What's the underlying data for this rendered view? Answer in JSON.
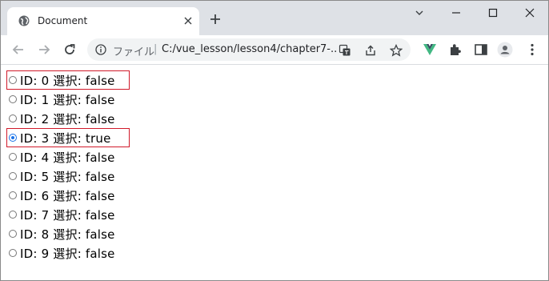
{
  "tab": {
    "title": "Document"
  },
  "omnibox": {
    "scheme_label": "ファイル",
    "separator": "|",
    "url": "C:/vue_lesson/lesson4/chapter7-..."
  },
  "colors": {
    "highlight_border": "#d11a2a",
    "radio_checked": "#1a73e8"
  },
  "items": [
    {
      "label": "ID: 0 選択: false",
      "checked": false,
      "highlighted": true
    },
    {
      "label": "ID: 1 選択: false",
      "checked": false,
      "highlighted": false
    },
    {
      "label": "ID: 2 選択: false",
      "checked": false,
      "highlighted": false
    },
    {
      "label": "ID: 3 選択: true",
      "checked": true,
      "highlighted": true
    },
    {
      "label": "ID: 4 選択: false",
      "checked": false,
      "highlighted": false
    },
    {
      "label": "ID: 5 選択: false",
      "checked": false,
      "highlighted": false
    },
    {
      "label": "ID: 6 選択: false",
      "checked": false,
      "highlighted": false
    },
    {
      "label": "ID: 7 選択: false",
      "checked": false,
      "highlighted": false
    },
    {
      "label": "ID: 8 選択: false",
      "checked": false,
      "highlighted": false
    },
    {
      "label": "ID: 9 選択: false",
      "checked": false,
      "highlighted": false
    }
  ]
}
